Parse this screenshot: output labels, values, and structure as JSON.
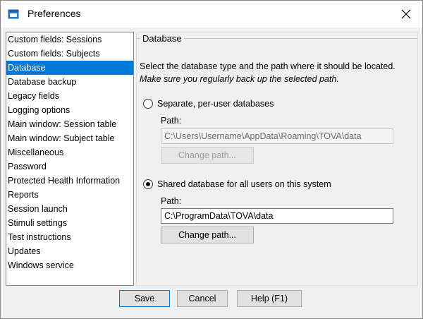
{
  "window": {
    "title": "Preferences"
  },
  "sidebar": {
    "items": [
      {
        "label": "Custom fields: Sessions"
      },
      {
        "label": "Custom fields: Subjects"
      },
      {
        "label": "Database"
      },
      {
        "label": "Database backup"
      },
      {
        "label": "Legacy fields"
      },
      {
        "label": "Logging options"
      },
      {
        "label": "Main window: Session table"
      },
      {
        "label": "Main window: Subject table"
      },
      {
        "label": "Miscellaneous"
      },
      {
        "label": "Password"
      },
      {
        "label": "Protected Health Information"
      },
      {
        "label": "Reports"
      },
      {
        "label": "Session launch"
      },
      {
        "label": "Stimuli settings"
      },
      {
        "label": "Test instructions"
      },
      {
        "label": "Updates"
      },
      {
        "label": "Windows service"
      }
    ],
    "selected": "Database"
  },
  "panel": {
    "group_title": "Database",
    "description": "Select the database type and the path where it should be located.",
    "description_italic": "Make sure you regularly back up the selected path.",
    "options": [
      {
        "label": "Separate, per-user databases",
        "checked": false,
        "path_label": "Path:",
        "path_value": "C:\\Users\\Username\\AppData\\Roaming\\TOVA\\data",
        "button": "Change path...",
        "enabled": false
      },
      {
        "label": "Shared database for all users on this system",
        "checked": true,
        "path_label": "Path:",
        "path_value": "C:\\ProgramData\\TOVA\\data",
        "button": "Change path...",
        "enabled": true
      }
    ]
  },
  "footer": {
    "save": "Save",
    "cancel": "Cancel",
    "help": "Help (F1)"
  },
  "colors": {
    "selection": "#0078d7",
    "window_bg": "#f0f0f0"
  },
  "icons": {
    "app": "app-window-icon",
    "close": "close-icon"
  }
}
